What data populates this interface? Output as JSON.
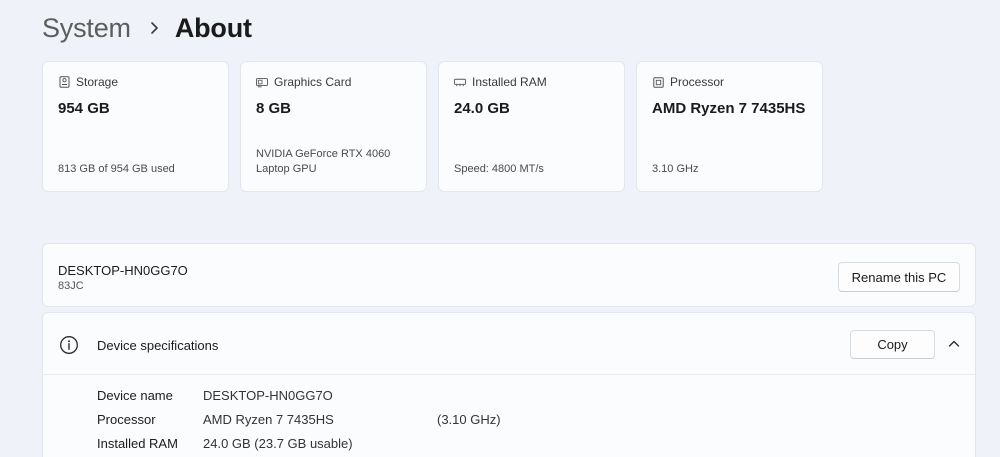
{
  "breadcrumb": {
    "parent": "System",
    "separator_icon": "chevron-right-icon",
    "current": "About"
  },
  "cards": [
    {
      "label": "Storage",
      "icon": "storage-icon",
      "value": "954 GB",
      "detail": "813 GB of 954 GB used"
    },
    {
      "label": "Graphics Card",
      "icon": "graphics-card-icon",
      "value": "8 GB",
      "detail": "NVIDIA GeForce RTX 4060 Laptop GPU"
    },
    {
      "label": "Installed RAM",
      "icon": "ram-icon",
      "value": "24.0 GB",
      "detail": "Speed: 4800 MT/s"
    },
    {
      "label": "Processor",
      "icon": "processor-icon",
      "value": "AMD Ryzen 7 7435HS",
      "detail": "3.10 GHz"
    }
  ],
  "pc": {
    "name": "DESKTOP-HN0GG7O",
    "model": "83JC",
    "rename_label": "Rename this PC"
  },
  "specs": {
    "title": "Device specifications",
    "copy_label": "Copy",
    "rows": [
      {
        "key": "Device name",
        "value": "DESKTOP-HN0GG7O",
        "extra": ""
      },
      {
        "key": "Processor",
        "value": "AMD Ryzen 7 7435HS",
        "extra": "(3.10 GHz)"
      },
      {
        "key": "Installed RAM",
        "value": "24.0 GB (23.7 GB usable)",
        "extra": ""
      }
    ]
  }
}
